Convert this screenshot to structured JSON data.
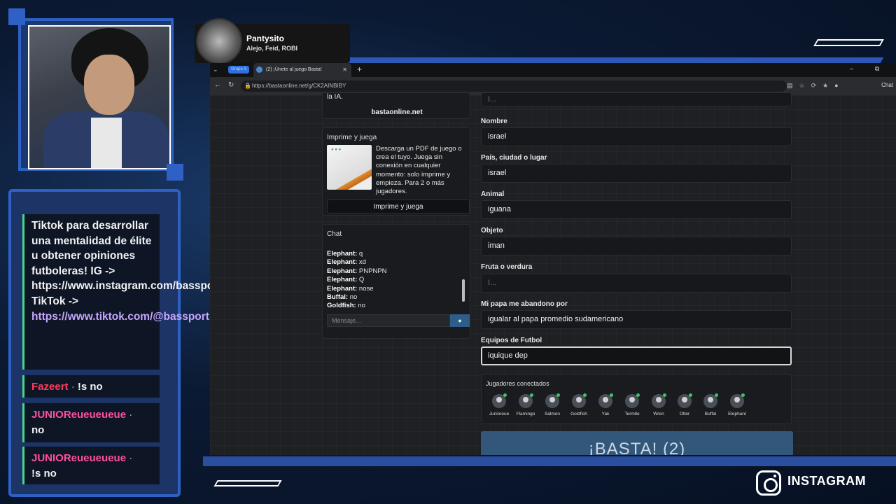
{
  "stream_chat": {
    "m1": {
      "text": "Tiktok para desarrollar una mentalidad de élite u obtener opiniones futboleras! IG -> https://www.instagram.com/bassports_/ TikTok ->",
      "link": "https://www.tiktok.com/@bassports_"
    },
    "m2": {
      "user": "Fazeert",
      "text": "!s no",
      "color": "#ff3b5c"
    },
    "m3": {
      "user": "JUNIOReueueueue",
      "text": "no",
      "color": "#ff4fa0"
    },
    "m4": {
      "user": "JUNIOReueueueue",
      "text": "!s no",
      "color": "#ff4fa0"
    }
  },
  "now_playing": {
    "title": "Pantysito",
    "artists": "Alejo, Feid, ROBI"
  },
  "browser": {
    "group_label": "Grupo 3",
    "tab_title": "(2) ¡Únete al juego Basta!",
    "url": "https://bastaonline.net/g/CK2AINBIBY",
    "chat_button": "Chat"
  },
  "sidebar": {
    "ia_text": "la IA.",
    "site": "bastaonline.net",
    "print": {
      "title": "Imprime y juega",
      "desc": "Descarga un PDF de juego o crea el tuyo. Juega sin conexión en cualquier momento: solo imprime y empieza. Para 2 o más jugadores.",
      "button": "Imprime y juega"
    },
    "chat": {
      "title": "Chat",
      "lines": [
        {
          "user": "Elephant:",
          "text": "q"
        },
        {
          "user": "Elephant:",
          "text": "xd"
        },
        {
          "user": "Elephant:",
          "text": "PNPNPN"
        },
        {
          "user": "Elephant:",
          "text": "Q"
        },
        {
          "user": "Elephant:",
          "text": "nose"
        },
        {
          "user": "Buffal:",
          "text": "no"
        },
        {
          "user": "Goldfish:",
          "text": "no"
        }
      ],
      "placeholder": "Mensaje..."
    }
  },
  "form": {
    "top_placeholder": "I...",
    "fields": [
      {
        "label": "Nombre",
        "value": "israel"
      },
      {
        "label": "País, ciudad o lugar",
        "value": "israel"
      },
      {
        "label": "Animal",
        "value": "iguana"
      },
      {
        "label": "Objeto",
        "value": "iman"
      },
      {
        "label": "Fruta o verdura",
        "placeholder": "I..."
      },
      {
        "label": "Mi papa me abandono por",
        "value": "igualar al papa promedio sudamericano"
      },
      {
        "label": "Equipos de Futbol",
        "value": "iquique dep"
      }
    ]
  },
  "players": {
    "title": "Jugadores conectados",
    "list": [
      "Junioreue",
      "Flamingo",
      "Salmon",
      "Goldfish",
      "Yak",
      "Termite",
      "Wren",
      "Otter",
      "Buffal",
      "Elephant"
    ]
  },
  "basta_button": "¡BASTA! (2)",
  "instagram": "INSTAGRAM"
}
